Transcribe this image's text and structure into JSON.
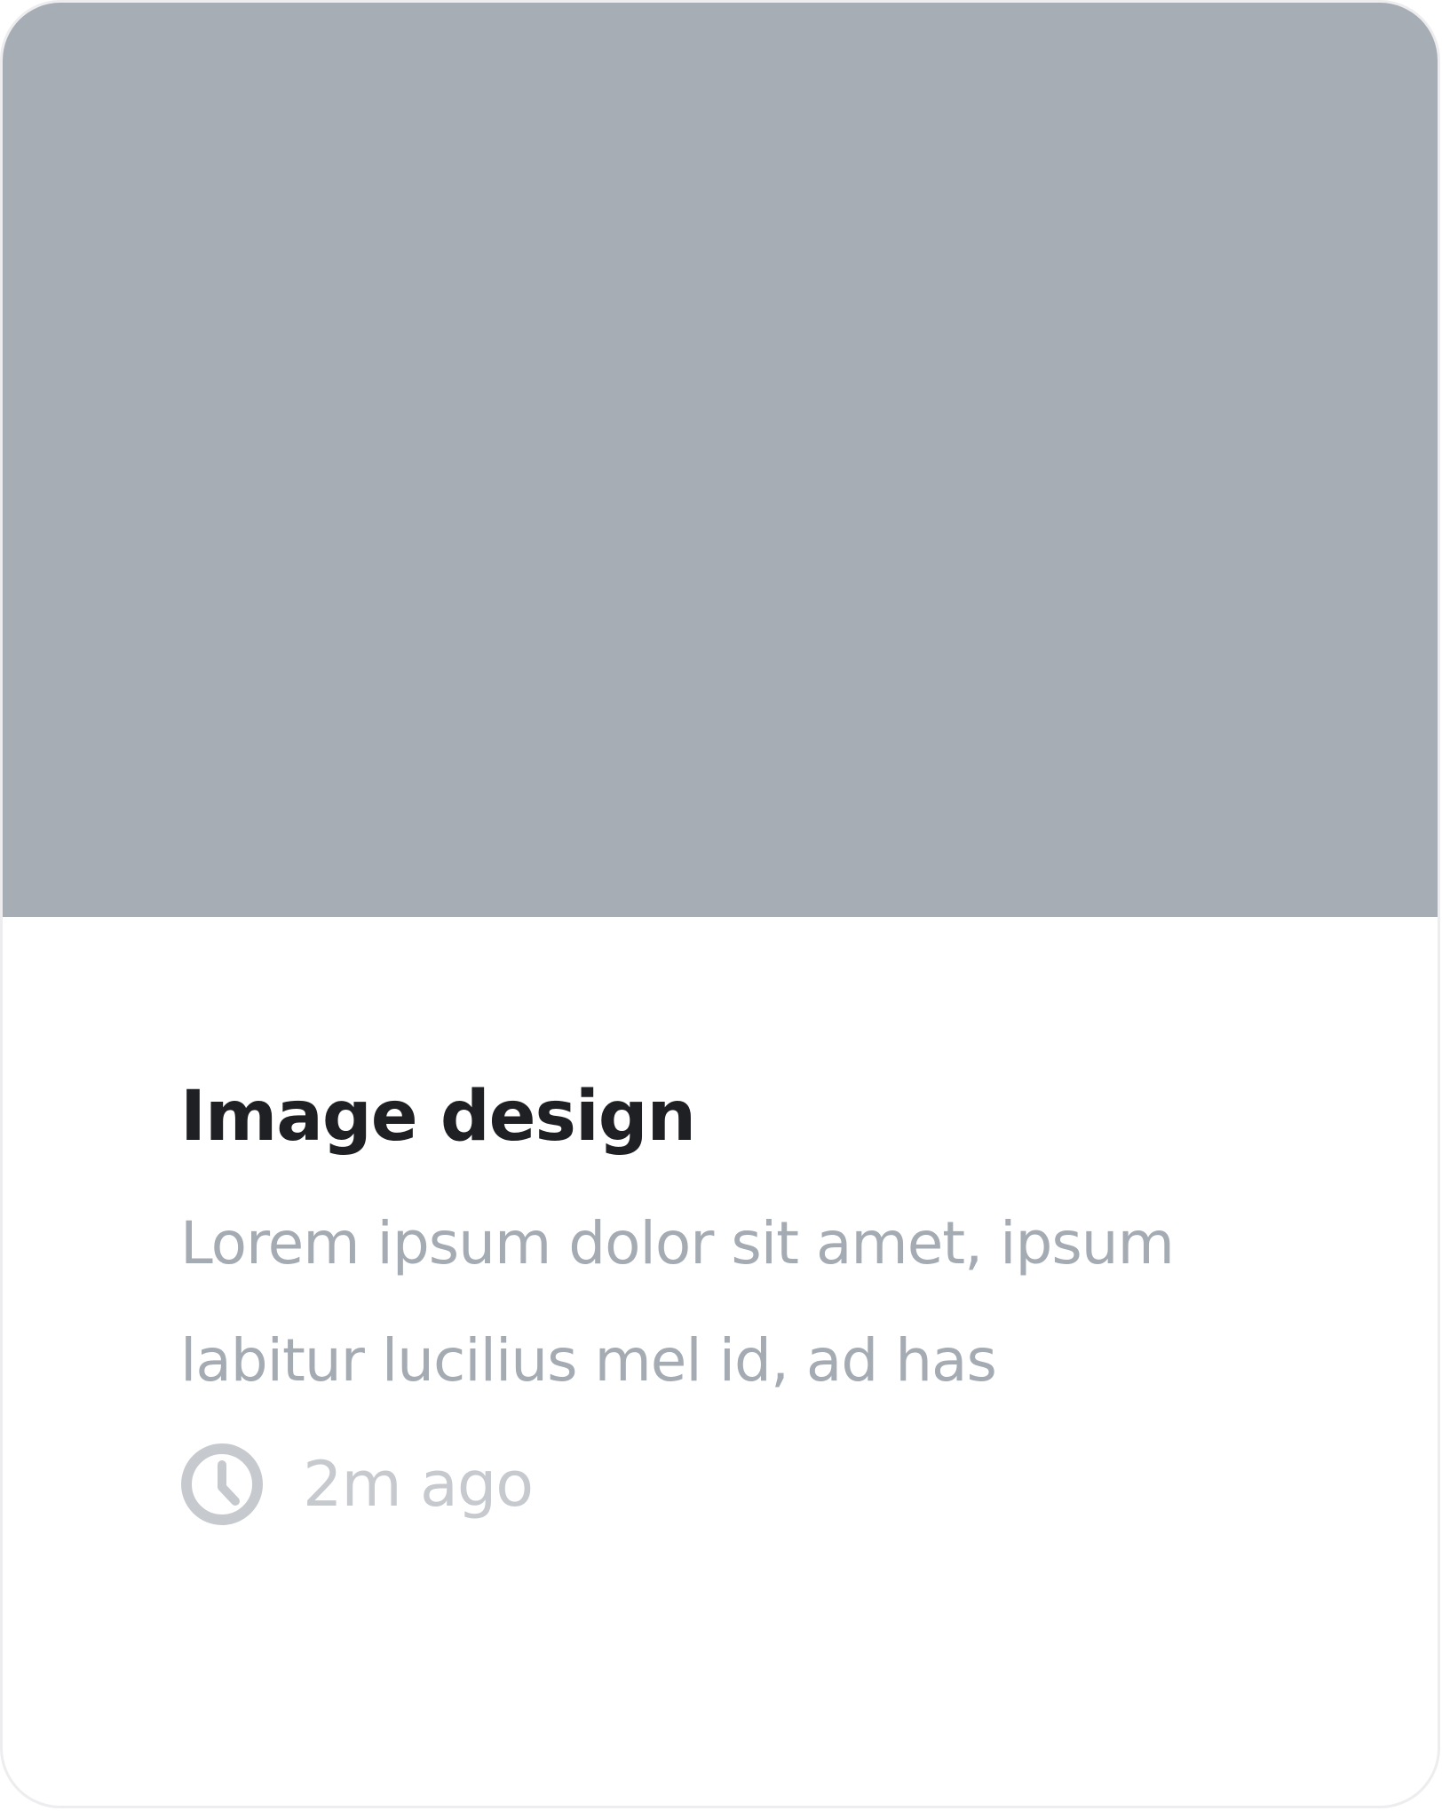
{
  "card": {
    "image": {
      "color": "#a7adb5"
    },
    "title": "Image design",
    "description": "Lorem ipsum dolor sit amet, ipsum labitur lucilius mel id, ad has",
    "meta": {
      "icon": "clock-icon",
      "time": "2m ago"
    }
  }
}
